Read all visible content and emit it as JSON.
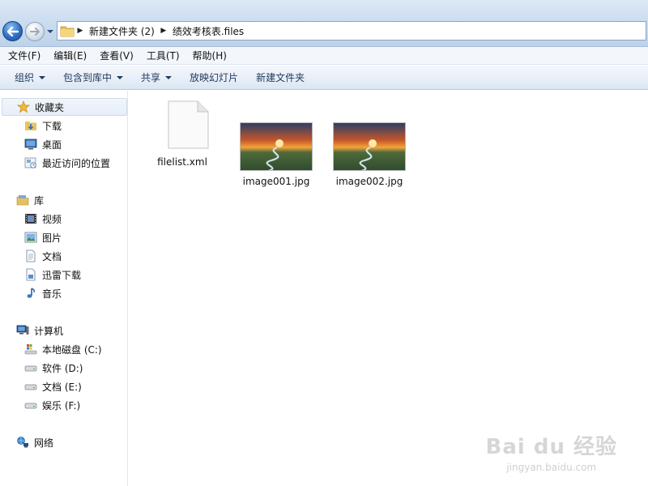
{
  "address_bar": {
    "crumbs": [
      "新建文件夹 (2)",
      "绩效考核表.files"
    ]
  },
  "menu": [
    "文件(F)",
    "编辑(E)",
    "查看(V)",
    "工具(T)",
    "帮助(H)"
  ],
  "toolbar": {
    "organize": "组织",
    "include_in_library": "包含到库中",
    "share": "共享",
    "slideshow": "放映幻灯片",
    "new_folder": "新建文件夹"
  },
  "sidebar": {
    "favorites": {
      "label": "收藏夹",
      "items": [
        "下载",
        "桌面",
        "最近访问的位置"
      ]
    },
    "libraries": {
      "label": "库",
      "items": [
        "视频",
        "图片",
        "文档",
        "迅雷下载",
        "音乐"
      ]
    },
    "computer": {
      "label": "计算机",
      "items": [
        "本地磁盘 (C:)",
        "软件 (D:)",
        "文档 (E:)",
        "娱乐 (F:)"
      ]
    },
    "network": {
      "label": "网络"
    }
  },
  "files": [
    {
      "name": "filelist.xml",
      "icon": "xml-file-icon"
    },
    {
      "name": "image001.jpg",
      "icon": "image-thumbnail"
    },
    {
      "name": "image002.jpg",
      "icon": "image-thumbnail"
    }
  ],
  "watermark": {
    "main": "Bai du 经验",
    "sub": "jingyan.baidu.com"
  }
}
